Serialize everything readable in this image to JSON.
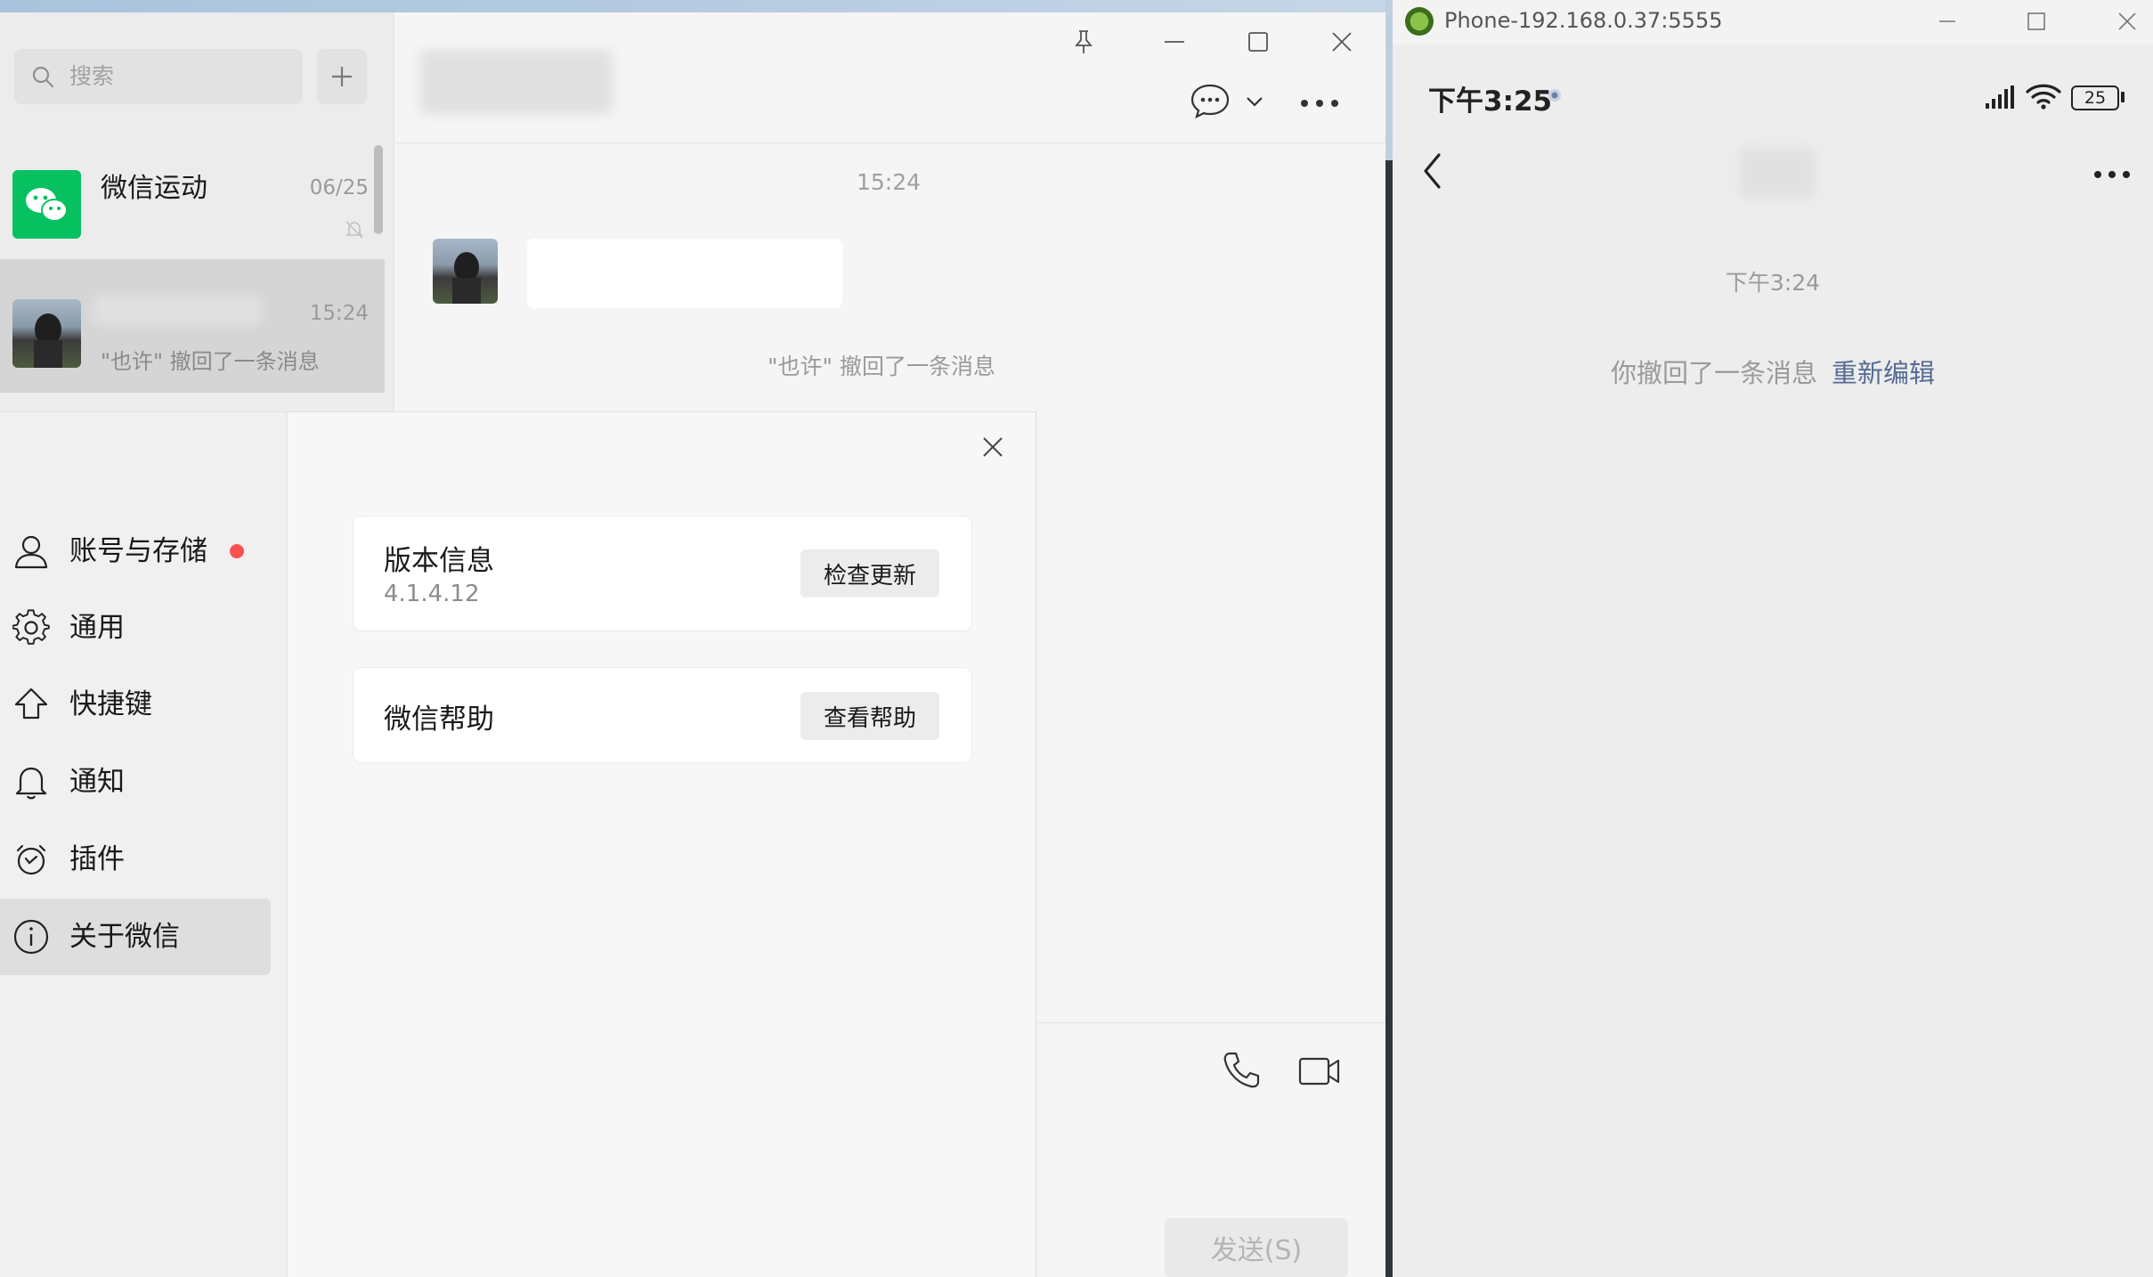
{
  "wechat": {
    "search": {
      "placeholder": "搜索"
    },
    "sessions": [
      {
        "name": "微信运动",
        "time": "06/25"
      },
      {
        "name": "",
        "time": "15:24",
        "preview": "\"也许\" 撤回了一条消息"
      }
    ],
    "chat": {
      "timestamp": "15:24",
      "recall_notice": "\"也许\" 撤回了一条消息",
      "send_label": "发送(S)"
    },
    "settings": {
      "nav": [
        {
          "label": "账号与存储",
          "icon": "user-icon"
        },
        {
          "label": "通用",
          "icon": "gear-icon"
        },
        {
          "label": "快捷键",
          "icon": "shortcut-icon"
        },
        {
          "label": "通知",
          "icon": "bell-icon"
        },
        {
          "label": "插件",
          "icon": "plugin-icon"
        },
        {
          "label": "关于微信",
          "icon": "info-icon"
        }
      ],
      "version_card": {
        "title": "版本信息",
        "version": "4.1.4.12",
        "button": "检查更新"
      },
      "help_card": {
        "title": "微信帮助",
        "button": "查看帮助"
      }
    }
  },
  "phone": {
    "window_title": "Phone-192.168.0.37:5555",
    "status_time": "下午3:25",
    "battery": "25",
    "timestamp": "下午3:24",
    "recall_text": "你撤回了一条消息",
    "reedit_label": "重新编辑"
  },
  "colors": {
    "wechat_green": "#07c160",
    "link_blue": "#576b95",
    "red_dot": "#fa5151"
  }
}
